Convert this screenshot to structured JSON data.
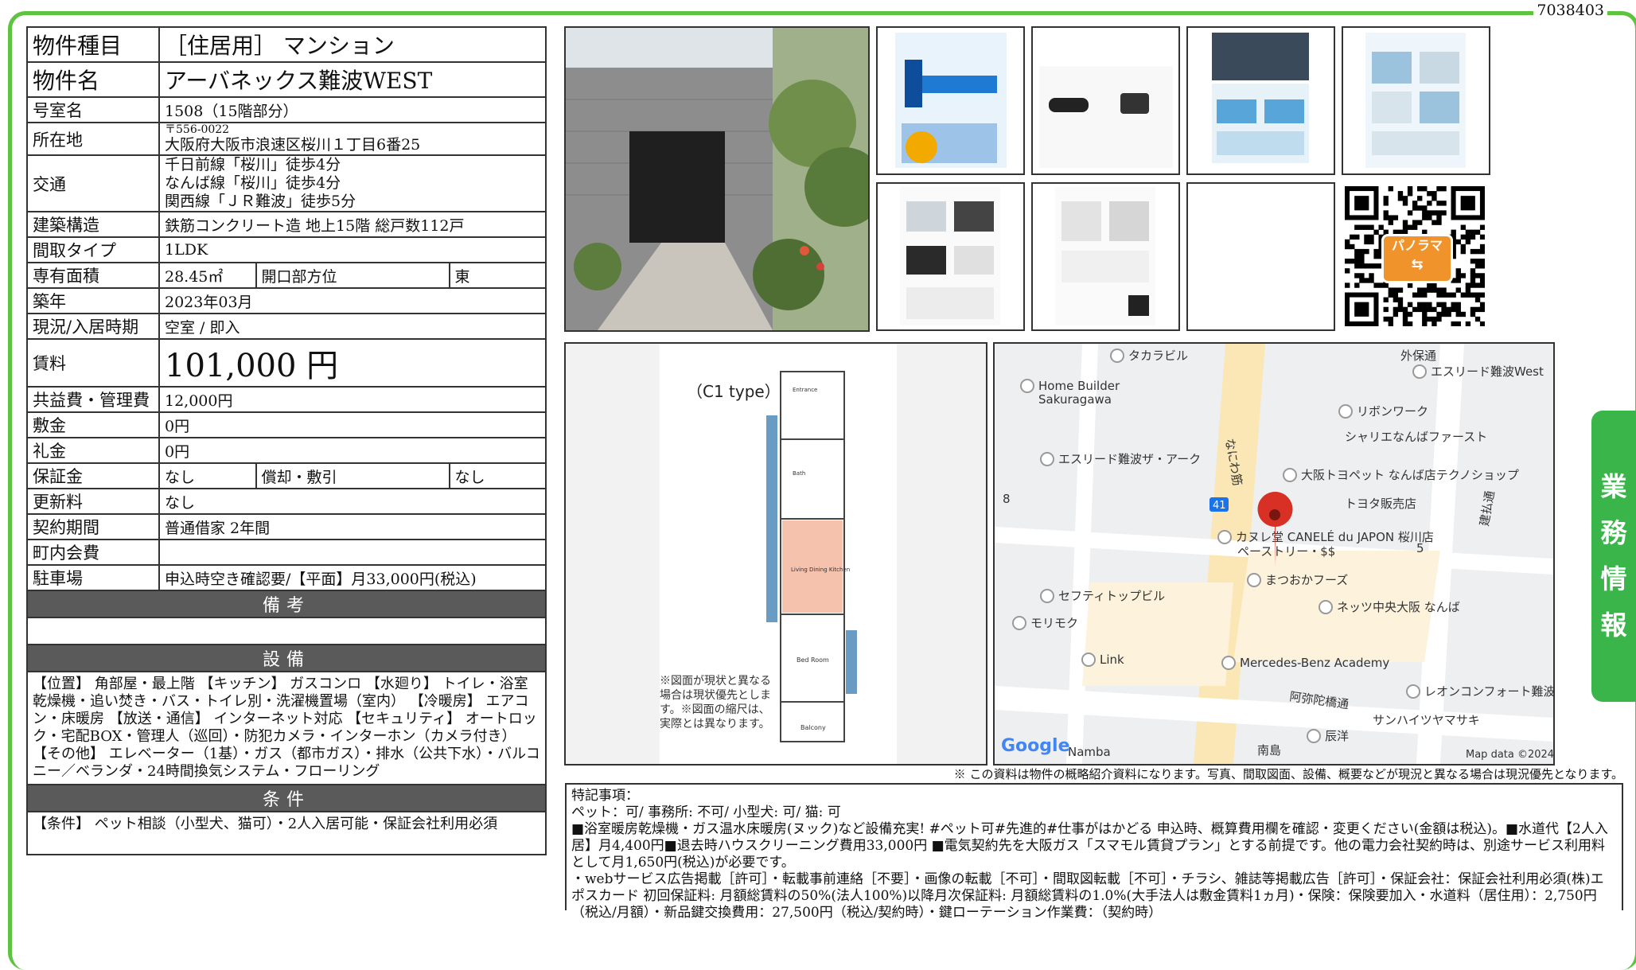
{
  "doc_id": "7038403",
  "side_tab": [
    "業",
    "務",
    "情",
    "報"
  ],
  "spec": {
    "type_label": "物件種目",
    "type_value": "［住居用］ マンション",
    "name_label": "物件名",
    "name_value": "アーバネックス難波WEST",
    "room_label": "号室名",
    "room_value": "1508（15階部分）",
    "addr_label": "所在地",
    "addr_zip": "〒556-0022",
    "addr_value": "大阪府大阪市浪速区桜川１丁目6番25",
    "access_label": "交通",
    "access": [
      "千日前線「桜川」徒歩4分",
      "なんば線「桜川」徒歩4分",
      "関西線「ＪＲ難波」徒歩5分"
    ],
    "structure_label": "建築構造",
    "structure_value": "鉄筋コンクリート造 地上15階 総戸数112戸",
    "layout_label": "間取タイプ",
    "layout_value": "1LDK",
    "area_label": "専有面積",
    "area_value": "28.45㎡",
    "direction_label": "開口部方位",
    "direction_value": "東",
    "built_label": "築年",
    "built_value": "2023年03月",
    "status_label": "現況/入居時期",
    "status_value": "空室 / 即入",
    "rent_label": "賃料",
    "rent_value": "101,000 円",
    "fee_label": "共益費・管理費",
    "fee_value": "12,000円",
    "deposit_label": "敷金",
    "deposit_value": "0円",
    "key_label": "礼金",
    "key_value": "0円",
    "guarantee_label": "保証金",
    "guarantee_value": "なし",
    "amort_label": "償却・敷引",
    "amort_value": "なし",
    "renew_label": "更新料",
    "renew_value": "なし",
    "contract_label": "契約期間",
    "contract_value": "普通借家 2年間",
    "town_label": "町内会費",
    "town_value": "",
    "parking_label": "駐車場",
    "parking_value": "申込時空き確認要/【平面】月33,000円(税込)",
    "remarks_head": "備考",
    "facilities_head": "設備",
    "facilities": "【位置】 角部屋・最上階 【キッチン】 ガスコンロ 【水廻り】 トイレ・浴室乾燥機・追い焚き・バス・トイレ別・洗濯機置場（室内） 【冷暖房】 エアコン・床暖房 【放送・通信】 インターネット対応 【セキュリティ】 オートロック・宅配BOX・管理人（巡回）・防犯カメラ・インターホン（カメラ付き） 【その他】 エレベーター（1基）・ガス（都市ガス）・排水（公共下水）・バルコニー／ベランダ・24時間換気システム・フローリング",
    "conditions_head": "条件",
    "conditions": "【条件】 ペット相談（小型犬、猫可）・2人入居可能・保証会社利用必須"
  },
  "floorplan": {
    "title": "（C1 type）",
    "note": "※図面が現状と異なる場合は現状優先とします。※図面の縮尺は、実際とは異なります。",
    "room_ldk": "Living Dining Kitchen",
    "room_bed": "Bed Room",
    "balcony": "Balcony",
    "entrance": "Entrance",
    "bath": "Bath"
  },
  "panorama_label": "パノラマ",
  "map": {
    "labels": [
      "タカラビル",
      "外保通",
      "エスリード難波West",
      "Home Builder Sakuragawa",
      "リボンワーク",
      "シャリエなんばファースト",
      "エスリード難波ザ・アーク",
      "大阪トヨペット なんば店テクノショップ",
      "トヨタ販売店",
      "カヌレ堂 CANELÉ du JAPON 桜川店",
      "ペーストリー・$$",
      "まつおかフーズ",
      "ネッツ中央大阪 なんば",
      "セフティトップビル",
      "モリモク",
      "Link",
      "Mercedes-Benz Academy",
      "レオンコンフォート難波",
      "阿弥陀橋通",
      "サンハイツヤマサキ",
      "辰洋",
      "南島",
      "Namba",
      "なにわ筋",
      "建払通",
      "8",
      "41",
      "5"
    ],
    "google": "Google",
    "copyright": "Map data ©2024"
  },
  "disclaimer": "※ この資料は物件の概略紹介資料になります。写真、間取図面、設備、概要などが現況と異なる場合は現況優先となります。",
  "special": [
    "特記事項：",
    "ペット：可/ 事務所: 不可/ 小型犬: 可/ 猫: 可",
    "■浴室暖房乾燥機・ガス温水床暖房(ヌック)など設備充実! #ペット可#先進的#仕事がはかどる 申込時、概算費用欄を確認・変更ください(金額は税込)。■水道代【2人入居】月4,400円■退去時ハウスクリーニング費用33,000円 ■電気契約先を大阪ガス「スマモル賃貸プラン」とする前提です。他の電力会社契約時は、別途サービス利用料として月1,650円(税込)が必要です。",
    "・webサービス広告掲載［許可］・転載事前連絡［不要］・画像の転載［不可］・間取図転載［不可］・チラシ、雑誌等掲載広告［許可］・保証会社：保証会社利用必須(株)エポスカード 初回保証料: 月額総賃料の50%(法人100%)以降月次保証料: 月額総賃料の1.0%(大手法人は敷金賃料1ヵ月)・保険：保険要加入・水道料（居住用）：2,750円（税込/月額）・新品鍵交換費用：27,500円（税込/契約時）・鍵ローテーション作業費：（契約時）"
  ],
  "colors": {
    "frame": "#5ec43f",
    "side_tab": "#39b54a",
    "section_head": "#5a5a5a",
    "ldk": "#f5c2ae",
    "pin": "#d93025",
    "qr_badge": "#f0932b"
  }
}
